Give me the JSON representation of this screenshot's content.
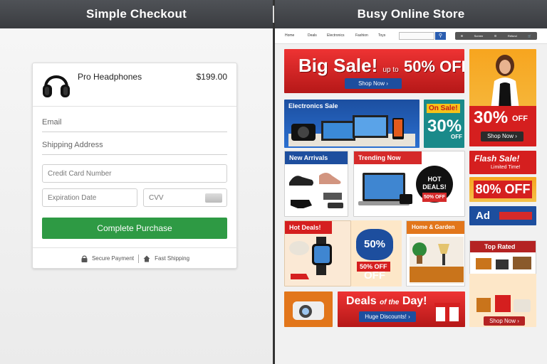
{
  "left_header": {
    "title": "Simple Checkout"
  },
  "right_header": {
    "title": "Busy Online Store"
  },
  "checkout": {
    "product_name": "Pro Headphones",
    "product_price": "$199.00",
    "email_placeholder": "Email",
    "shipping_placeholder": "Shipping Address",
    "card_placeholder": "Credit Card Number",
    "expiry_placeholder": "Expiration Date",
    "cvv_placeholder": "CVV",
    "button_label": "Complete Purchase",
    "secure_label": "Secure Payment",
    "shipping_label": "Fast Shipping"
  },
  "store": {
    "nav": [
      "Home",
      "Deals",
      "Electronics",
      "Fashion",
      "Toys"
    ],
    "nav_util": [
      "Screen",
      "Refund"
    ],
    "big_sale": {
      "title": "Big Sale!",
      "small": "up to",
      "pct": "50% OFF!",
      "button": "Shop Now"
    },
    "woman_tile": {
      "pct": "30%",
      "off": "OFF",
      "button": "Shop Now"
    },
    "electronics": {
      "label": "Electronics Sale"
    },
    "on_sale": {
      "tag": "On Sale!",
      "pct": "30%",
      "off": "OFF"
    },
    "new_arrivals": {
      "label": "New Arrivals"
    },
    "trending": {
      "label": "Trending Now",
      "badge_1": "HOT",
      "badge_2": "DEALS!",
      "badge_pct": "50% OFF"
    },
    "flash": {
      "title": "Flash Sale!",
      "sub": "Limited Time!"
    },
    "eighty": {
      "text": "80% OFF"
    },
    "ad": {
      "text": "Ad"
    },
    "hot_deals": {
      "label": "Hot Deals!"
    },
    "fifty": {
      "top": "50% OFF",
      "bottom": "50% OFF"
    },
    "home_garden": {
      "label": "Home & Garden"
    },
    "top_rated": {
      "label": "Top Rated"
    },
    "deals_day": {
      "title": "Deals",
      "of": "of the",
      "day": "Day!",
      "button": "Huge Discounts!"
    },
    "sofa": {
      "button": "Shop Now"
    }
  },
  "colors": {
    "green": "#2e9a44",
    "red": "#d51f1f",
    "blue": "#1d4e9e",
    "orange": "#f7a51f"
  }
}
